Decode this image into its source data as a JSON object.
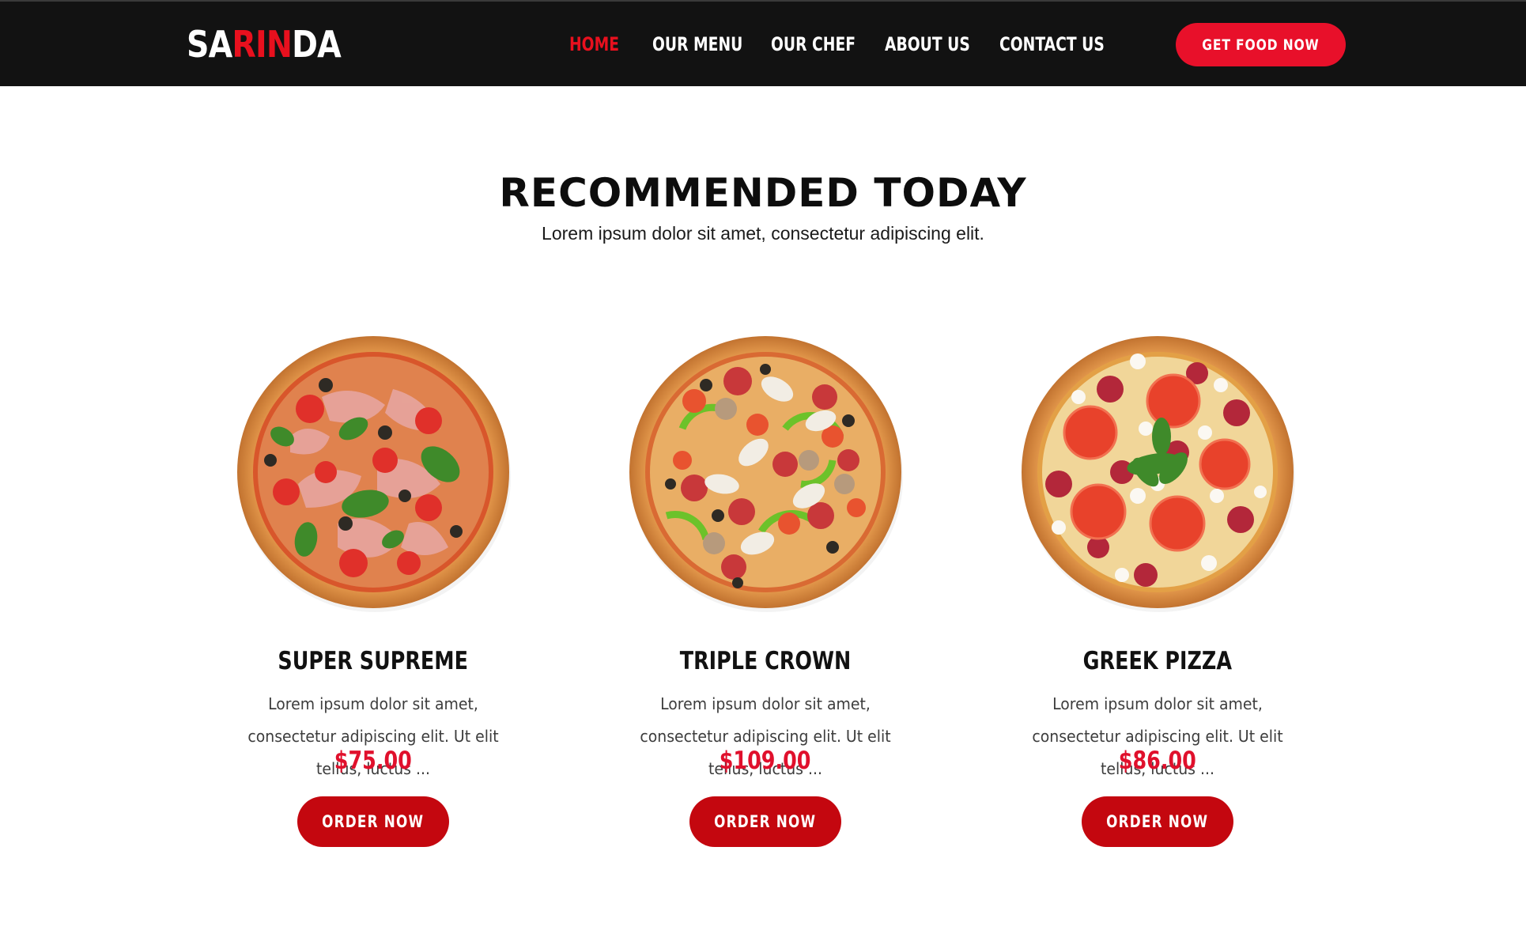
{
  "header": {
    "logo": {
      "part1": "SA",
      "part2": "RIN",
      "part3": "DA"
    },
    "nav": [
      {
        "label": "HOME",
        "active": true
      },
      {
        "label": "OUR MENU",
        "active": false
      },
      {
        "label": "OUR CHEF",
        "active": false
      },
      {
        "label": "ABOUT US",
        "active": false
      },
      {
        "label": "CONTACT US",
        "active": false
      }
    ],
    "cta_label": "GET FOOD NOW"
  },
  "section": {
    "title": "RECOMMENDED TODAY",
    "subtitle": "Lorem ipsum dolor sit amet, consectetur adipiscing elit."
  },
  "products": [
    {
      "name": "SUPER SUPREME",
      "description": "Lorem ipsum dolor sit amet, consectetur adipiscing elit. Ut elit tellus, luctus ...",
      "price": "$75.00",
      "button_label": "ORDER NOW",
      "image": "pizza-prosciutto-basil-image"
    },
    {
      "name": "TRIPLE CROWN",
      "description": "Lorem ipsum dolor sit amet, consectetur adipiscing elit. Ut elit tellus, luctus ...",
      "price": "$109.00",
      "button_label": "ORDER NOW",
      "image": "pizza-pepperoni-mushroom-pepper-image"
    },
    {
      "name": "GREEK PIZZA",
      "description": "Lorem ipsum dolor sit amet, consectetur adipiscing elit. Ut elit tellus, luctus ...",
      "price": "$86.00",
      "button_label": "ORDER NOW",
      "image": "pizza-tomato-salami-mozzarella-image"
    }
  ],
  "colors": {
    "header_bg": "#121212",
    "accent_red": "#e8101e",
    "price_red": "#e0102c",
    "button_red": "#c4070f",
    "cta_red": "#e8102a"
  }
}
